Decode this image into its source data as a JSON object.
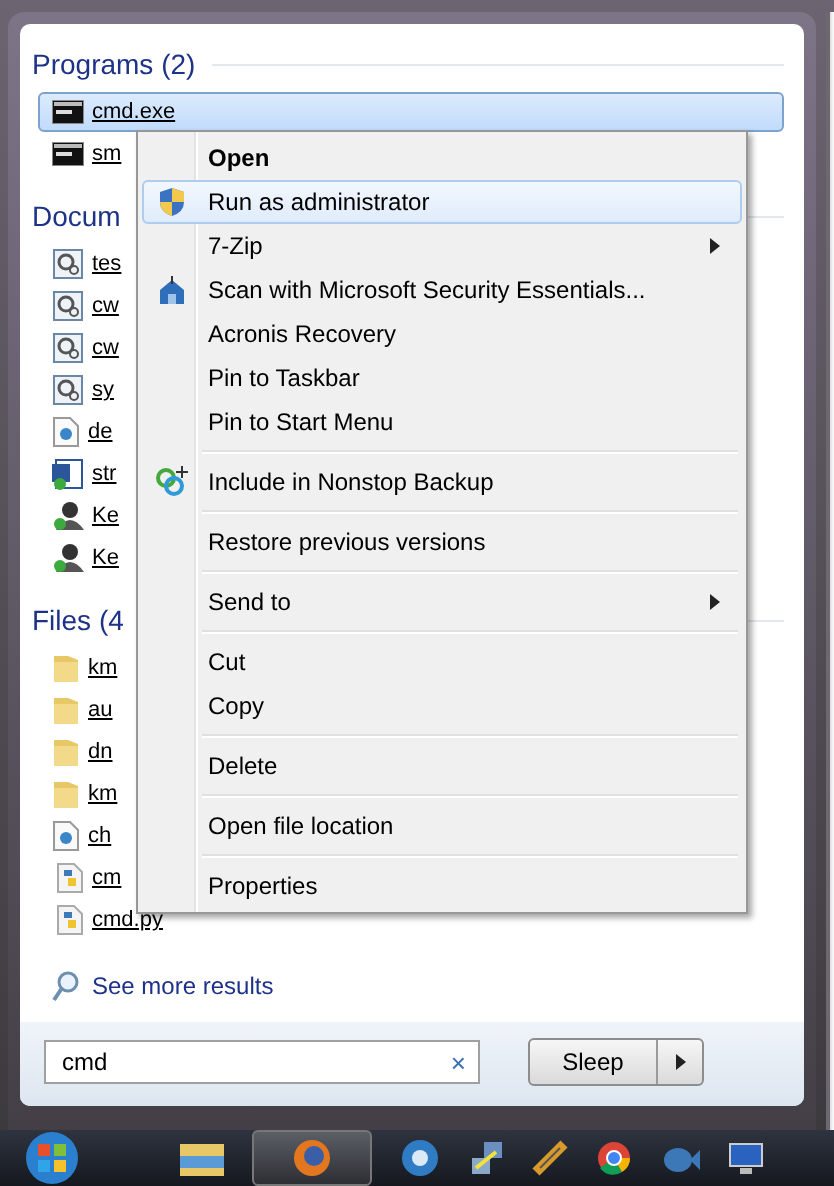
{
  "start_menu": {
    "groups": [
      {
        "header": "Programs (2)",
        "items": [
          {
            "name": "cmd.exe",
            "kind": "console",
            "selected": true
          },
          {
            "name": "sm",
            "kind": "console",
            "selected": false
          }
        ]
      },
      {
        "header": "Docum",
        "items": [
          {
            "name": "tes",
            "kind": "config",
            "selected": false
          },
          {
            "name": "cw",
            "kind": "config",
            "selected": false
          },
          {
            "name": "cw",
            "kind": "config",
            "selected": false
          },
          {
            "name": "sy",
            "kind": "config",
            "selected": false
          },
          {
            "name": "de",
            "kind": "web",
            "selected": false
          },
          {
            "name": "str",
            "kind": "word",
            "selected": false
          },
          {
            "name": "Ke",
            "kind": "user",
            "selected": false
          },
          {
            "name": "Ke",
            "kind": "user",
            "selected": false
          }
        ]
      },
      {
        "header": "Files (4",
        "items": [
          {
            "name": "km",
            "kind": "folder",
            "selected": false
          },
          {
            "name": "au",
            "kind": "folder",
            "selected": false
          },
          {
            "name": "dn",
            "kind": "folder",
            "selected": false
          },
          {
            "name": "km",
            "kind": "folder",
            "selected": false
          },
          {
            "name": "ch",
            "kind": "web",
            "selected": false
          },
          {
            "name": "cm",
            "kind": "python",
            "selected": false
          },
          {
            "name": "cmd.py",
            "kind": "python",
            "selected": false
          }
        ]
      }
    ],
    "see_more": "See more results",
    "search": {
      "value": "cmd",
      "clear": "×"
    },
    "power_button": {
      "label": "Sleep"
    }
  },
  "context_menu": [
    {
      "kind": "item",
      "label": "Open",
      "bold": true,
      "selected": false,
      "submenu": false
    },
    {
      "kind": "item",
      "label": "Run as administrator",
      "bold": false,
      "selected": true,
      "submenu": false
    },
    {
      "kind": "item",
      "label": "7-Zip",
      "bold": false,
      "selected": false,
      "submenu": true
    },
    {
      "kind": "item",
      "label": "Scan with Microsoft Security Essentials...",
      "bold": false,
      "selected": false,
      "submenu": false
    },
    {
      "kind": "item",
      "label": "Acronis Recovery",
      "bold": false,
      "selected": false,
      "submenu": false
    },
    {
      "kind": "item",
      "label": "Pin to Taskbar",
      "bold": false,
      "selected": false,
      "submenu": false
    },
    {
      "kind": "item",
      "label": "Pin to Start Menu",
      "bold": false,
      "selected": false,
      "submenu": false
    },
    {
      "kind": "separator"
    },
    {
      "kind": "item",
      "label": "Include in Nonstop Backup",
      "bold": false,
      "selected": false,
      "submenu": false
    },
    {
      "kind": "separator"
    },
    {
      "kind": "item",
      "label": "Restore previous versions",
      "bold": false,
      "selected": false,
      "submenu": false
    },
    {
      "kind": "separator"
    },
    {
      "kind": "item",
      "label": "Send to",
      "bold": false,
      "selected": false,
      "submenu": true
    },
    {
      "kind": "separator"
    },
    {
      "kind": "item",
      "label": "Cut",
      "bold": false,
      "selected": false,
      "submenu": false
    },
    {
      "kind": "item",
      "label": "Copy",
      "bold": false,
      "selected": false,
      "submenu": false
    },
    {
      "kind": "separator"
    },
    {
      "kind": "item",
      "label": "Delete",
      "bold": false,
      "selected": false,
      "submenu": false
    },
    {
      "kind": "separator"
    },
    {
      "kind": "item",
      "label": "Open file location",
      "bold": false,
      "selected": false,
      "submenu": false
    },
    {
      "kind": "separator"
    },
    {
      "kind": "item",
      "label": "Properties",
      "bold": false,
      "selected": false,
      "submenu": false
    }
  ]
}
